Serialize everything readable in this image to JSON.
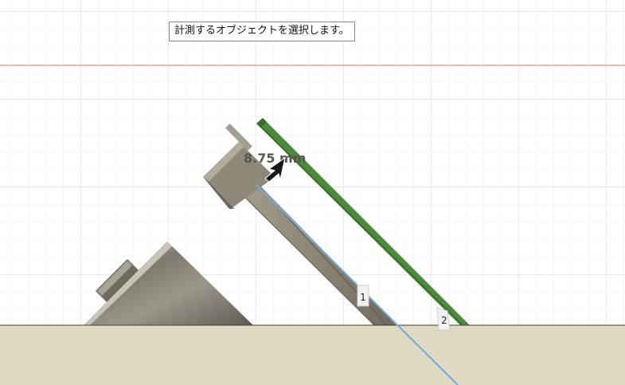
{
  "tooltip": {
    "text": "計測するオブジェクトを選択します。"
  },
  "measurement": {
    "value": "8.75 mm"
  },
  "markers": {
    "first": "1",
    "second": "2"
  },
  "icons": {
    "cursor": "arrow-cursor-icon"
  },
  "colors": {
    "ground": "#e0d8c0",
    "grid_minor": "#eeeeee",
    "grid_major": "#d6d6d6",
    "axis_line": "#e57373",
    "green_board": "#4e8a3e",
    "highlight": "#6aaee8",
    "part_body": "#8e8878"
  }
}
